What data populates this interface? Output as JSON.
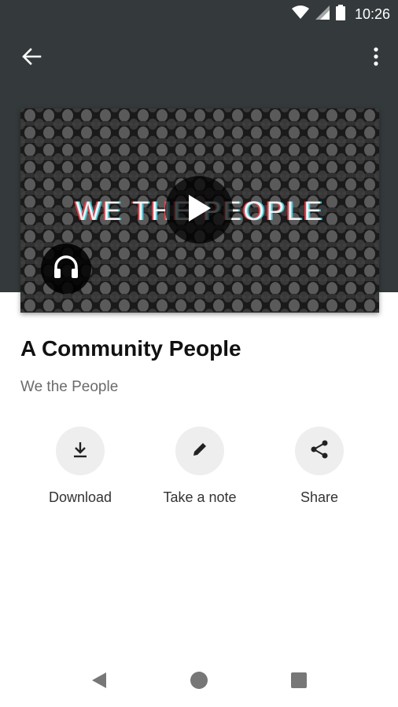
{
  "status_bar": {
    "time": "10:26"
  },
  "top_bar": {
    "back_icon": "arrow-left-icon",
    "more_icon": "more-vert-icon"
  },
  "hero": {
    "image_text": "WE THE PEOPLE",
    "play_icon": "play-icon",
    "badge_icon": "headphones-icon"
  },
  "episode": {
    "title": "A Community People",
    "show": "We the People"
  },
  "actions": [
    {
      "label": "Download",
      "icon": "download-icon"
    },
    {
      "label": "Take a note",
      "icon": "pencil-icon"
    },
    {
      "label": "Share",
      "icon": "share-icon"
    }
  ],
  "nav_bar": {
    "back": "nav-back-icon",
    "home": "nav-home-icon",
    "recents": "nav-recents-icon"
  },
  "colors": {
    "header": "#343a3c",
    "action_bg": "#eeeeee",
    "text_primary": "#111111",
    "text_secondary": "#6b6b6b"
  }
}
